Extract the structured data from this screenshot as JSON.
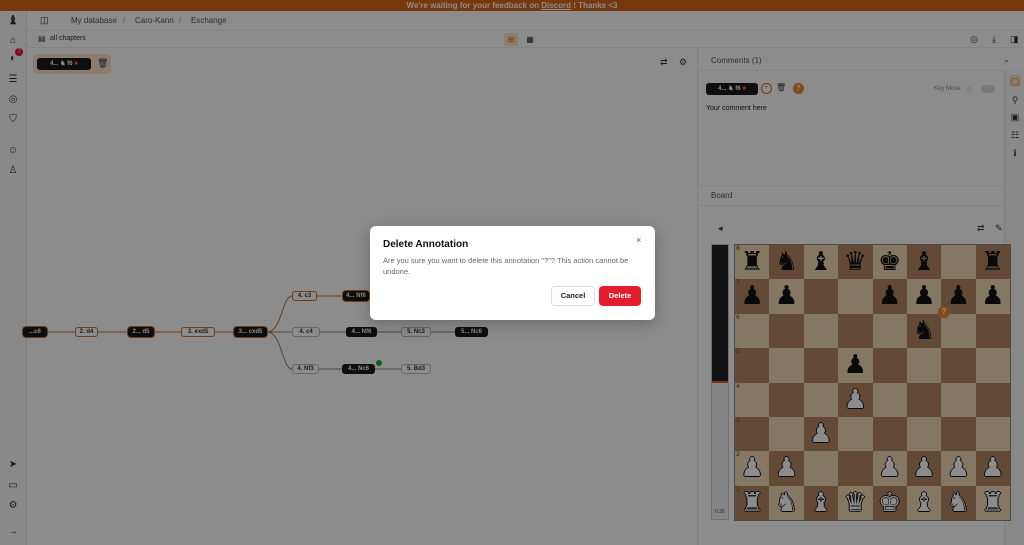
{
  "banner": {
    "prefix": "We're waiting for your feedback on ",
    "link": "Discord",
    "suffix": " ! Thanks <3"
  },
  "leftbar": {
    "notification_count": "7"
  },
  "breadcrumb": {
    "root": "My database",
    "sep": "/",
    "level1": "Caro-Kann",
    "level2": "Exchange"
  },
  "subbar": {
    "all_chapters": "all chapters"
  },
  "selected_move": {
    "num": "4...",
    "piece": "♞",
    "square": "f6"
  },
  "tree": {
    "nodes": [
      {
        "label": "...c6",
        "style": "black"
      },
      {
        "label": "2. d4",
        "style": "white"
      },
      {
        "label": "2... d5",
        "style": "black"
      },
      {
        "label": "3. exd5",
        "style": "white"
      },
      {
        "label": "3... cxd5",
        "style": "black"
      },
      {
        "label": "4. c3",
        "style": "white"
      },
      {
        "label": "4... Nf6",
        "style": "black"
      },
      {
        "label": "4. c4",
        "style": "white"
      },
      {
        "label": "4... Nf6",
        "style": "black"
      },
      {
        "label": "5. Nc3",
        "style": "white"
      },
      {
        "label": "5... Nc6",
        "style": "black"
      },
      {
        "label": "4. Nf3",
        "style": "white"
      },
      {
        "label": "4... Nc6",
        "style": "black"
      },
      {
        "label": "5. Bd3",
        "style": "white"
      }
    ]
  },
  "comments": {
    "title": "Comments (1)",
    "placeholder": "Your comment here",
    "key_move": "Key Move",
    "annotation": "?"
  },
  "board_section": {
    "title": "Board",
    "eval": "0.35"
  },
  "board": {
    "ranks": [
      "8",
      "7",
      "6",
      "5",
      "4",
      "3",
      "2",
      "1"
    ],
    "position": [
      [
        "bR",
        "bN",
        "bB",
        "bQ",
        "bK",
        "bB",
        "",
        "bR"
      ],
      [
        "bP",
        "bP",
        "",
        "",
        "bP",
        "bP",
        "bP",
        "bP"
      ],
      [
        "",
        "",
        "",
        "",
        "",
        "bN",
        "",
        ""
      ],
      [
        "",
        "",
        "",
        "bP",
        "",
        "",
        "",
        ""
      ],
      [
        "",
        "",
        "",
        "wP",
        "",
        "",
        "",
        ""
      ],
      [
        "",
        "",
        "wP",
        "",
        "",
        "",
        "",
        ""
      ],
      [
        "wP",
        "wP",
        "",
        "",
        "wP",
        "wP",
        "wP",
        "wP"
      ],
      [
        "wR",
        "wN",
        "wB",
        "wQ",
        "wK",
        "wB",
        "wN",
        "wR"
      ]
    ]
  },
  "modal": {
    "title": "Delete Annotation",
    "message": "Are you sure you want to delete this annotation \"?\"? This action cannot be undone.",
    "cancel": "Cancel",
    "delete": "Delete",
    "close": "×"
  }
}
